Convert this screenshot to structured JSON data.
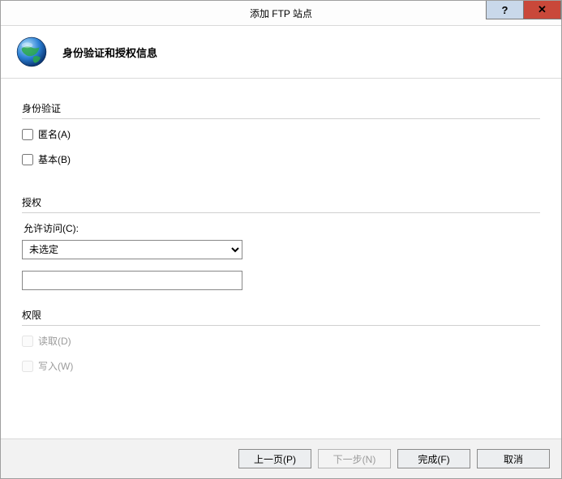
{
  "window": {
    "title": "添加 FTP 站点"
  },
  "header": {
    "subtitle": "身份验证和授权信息",
    "icon_name": "globe-icon"
  },
  "auth": {
    "group_label": "身份验证",
    "anonymous_label": "匿名(A)",
    "anonymous_checked": false,
    "basic_label": "基本(B)",
    "basic_checked": false
  },
  "authorization": {
    "group_label": "授权",
    "allow_access_label": "允许访问(C):",
    "selected_option": "未选定",
    "text_value": ""
  },
  "permissions": {
    "group_label": "权限",
    "read_label": "读取(D)",
    "read_checked": false,
    "write_label": "写入(W)",
    "write_checked": false
  },
  "footer": {
    "back_label": "上一页(P)",
    "next_label": "下一步(N)",
    "finish_label": "完成(F)",
    "cancel_label": "取消"
  }
}
